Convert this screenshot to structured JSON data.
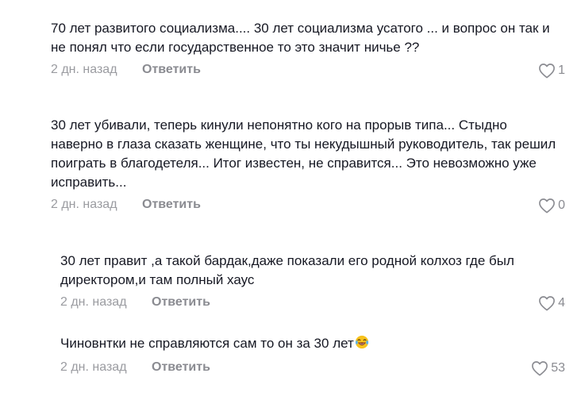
{
  "comments": [
    {
      "text": "70 лет развитого социализма.... 30 лет социализма усатого ... и вопрос он так и\nне понял что если государственное то это значит ничье ??",
      "time": "2 дн. назад",
      "reply_label": "Ответить",
      "likes": "1"
    },
    {
      "text": "30 лет убивали, теперь кинули непонятно кого на прорыв типа... Стыдно\nнаверно в глаза сказать женщине, что ты некудышный руководитель, так решил\nпоиграть в благодетеля... Итог известен, не справится... Это невозможно уже\nисправить...",
      "time": "2 дн. назад",
      "reply_label": "Ответить",
      "likes": "0"
    },
    {
      "text": "30 лет правит ,а такой бардак,даже показали его родной колхоз где был\nдиректором,и там полный хаус",
      "time": "2 дн. назад",
      "reply_label": "Ответить",
      "likes": "4"
    },
    {
      "text": "Чиновнтки не справляются сам то он за 30 лет",
      "emoji": "laughing-crying-face",
      "time": "2 дн. назад",
      "reply_label": "Ответить",
      "likes": "53"
    }
  ],
  "icons": {
    "like": "heart-outline-icon",
    "emoji": "laughing-crying-face-icon"
  },
  "colors": {
    "text": "#161823",
    "muted": "#9a9ba0",
    "reply": "#8a8b91",
    "heart": "#8a8b91"
  }
}
